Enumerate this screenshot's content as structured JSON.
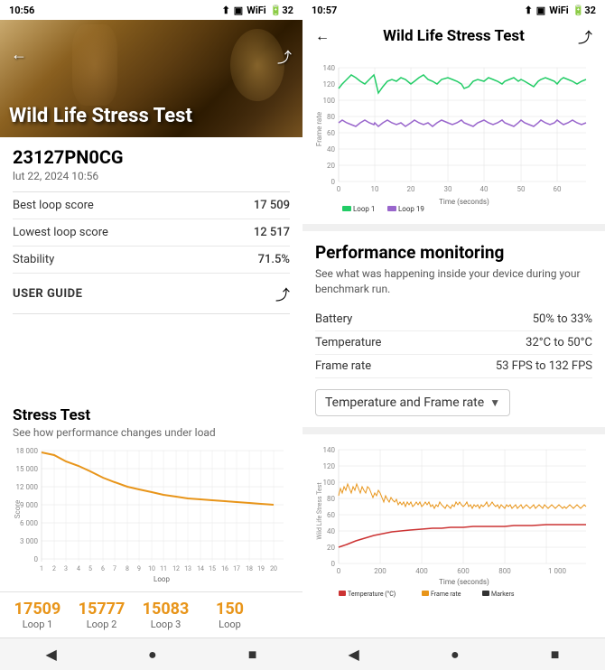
{
  "left": {
    "statusBar": {
      "time": "10:56",
      "signal": "▲",
      "battery": "32"
    },
    "hero": {
      "title": "Wild Life Stress Test"
    },
    "deviceId": "23127PN0CG",
    "date": "lut 22, 2024 10:56",
    "stats": [
      {
        "label": "Best loop score",
        "value": "17 509"
      },
      {
        "label": "Lowest loop score",
        "value": "12 517"
      },
      {
        "label": "Stability",
        "value": "71.5%"
      }
    ],
    "userGuide": "USER GUIDE",
    "stressTest": {
      "title": "Stress Test",
      "subtitle": "See how performance changes under load"
    },
    "loopScores": [
      {
        "score": "17509",
        "label": "Loop 1",
        "color": "#E8951A"
      },
      {
        "score": "15777",
        "label": "Loop 2",
        "color": "#E8951A"
      },
      {
        "score": "15083",
        "label": "Loop 3",
        "color": "#E8951A"
      },
      {
        "score": "150",
        "label": "Loop",
        "color": "#E8951A"
      }
    ],
    "chartYLabels": [
      "18 000",
      "15 000",
      "12 000",
      "9 000",
      "6 000",
      "3 000",
      "0"
    ],
    "chartXLabels": [
      "1",
      "2",
      "3",
      "4",
      "5",
      "6",
      "7",
      "8",
      "9",
      "10",
      "11",
      "12",
      "13",
      "14",
      "15",
      "16",
      "17",
      "18",
      "19",
      "20"
    ]
  },
  "right": {
    "statusBar": {
      "time": "10:57",
      "battery": "32"
    },
    "title": "Wild Life Stress Test",
    "frameChart": {
      "yMax": 140,
      "yLabels": [
        "140",
        "120",
        "100",
        "80",
        "60",
        "40",
        "20",
        "0"
      ],
      "xLabels": [
        "0",
        "10",
        "20",
        "30",
        "40",
        "50",
        "60"
      ],
      "yAxisLabel": "Frame rate",
      "xAxisLabel": "Time (seconds)",
      "legend": [
        {
          "label": "Loop 1",
          "color": "#22cc66"
        },
        {
          "label": "Loop 19",
          "color": "#9966cc"
        }
      ]
    },
    "performance": {
      "title": "Performance monitoring",
      "description": "See what was happening inside your device during your benchmark run.",
      "rows": [
        {
          "key": "Battery",
          "value": "50% to 33%"
        },
        {
          "key": "Temperature",
          "value": "32°C to 50°C"
        },
        {
          "key": "Frame rate",
          "value": "53 FPS to 132 FPS"
        }
      ],
      "dropdown": "Temperature and Frame rate"
    },
    "tempChart": {
      "yMax": 140,
      "yLabels": [
        "140",
        "120",
        "100",
        "80",
        "60",
        "40",
        "20",
        "0"
      ],
      "xLabels": [
        "0",
        "200",
        "400",
        "600",
        "800",
        "1 000"
      ],
      "yAxisLabel": "Wild Life Stress Test",
      "xAxisLabel": "Time (seconds)",
      "legend": [
        {
          "label": "Temperature (°C)",
          "color": "#cc3333"
        },
        {
          "label": "Frame rate",
          "color": "#E8951A"
        },
        {
          "label": "Markers",
          "color": "#333333"
        }
      ]
    }
  },
  "nav": {
    "back": "◀",
    "home": "●",
    "square": "■"
  }
}
